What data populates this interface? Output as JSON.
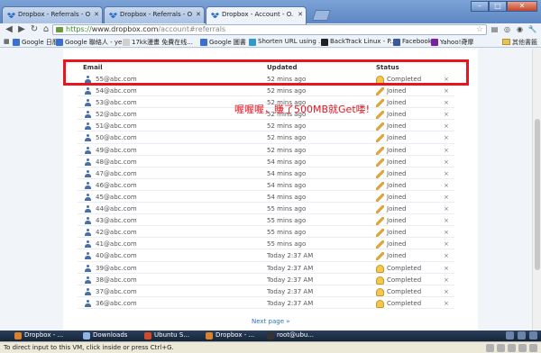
{
  "browser": {
    "tabs": [
      {
        "title": "Dropbox - Referrals - O...",
        "active": false
      },
      {
        "title": "Dropbox - Referrals - O...",
        "active": false
      },
      {
        "title": "Dropbox - Account - O...",
        "active": true
      }
    ],
    "url": {
      "protocol": "https://",
      "domain": "www.dropbox.com",
      "path": "/account#referrals"
    },
    "bookmarks": [
      {
        "label": "Google 日曆",
        "color": "#3b6fd1"
      },
      {
        "label": "Google 聯絡人 - ye...",
        "color": "#3b6fd1"
      },
      {
        "label": "17kk漫畫 免費在线...",
        "color": "#d0d0d0"
      },
      {
        "label": "Google 圖書",
        "color": "#3b6fd1"
      },
      {
        "label": "Shorten URL using ...",
        "color": "#3399cc"
      },
      {
        "label": "BackTrack Linux - P...",
        "color": "#222222"
      },
      {
        "label": "Facebook",
        "color": "#3b5998"
      },
      {
        "label": "Yahoo!奇摩",
        "color": "#7b1fa2"
      }
    ],
    "other_bookmarks": "其他書籤"
  },
  "referrals": {
    "columns": {
      "email": "Email",
      "updated": "Updated",
      "status": "Status"
    },
    "rows": [
      {
        "email": "55@abc.com",
        "updated": "52 mins ago",
        "status": "Completed"
      },
      {
        "email": "54@abc.com",
        "updated": "52 mins ago",
        "status": "Joined"
      },
      {
        "email": "53@abc.com",
        "updated": "52 mins ago",
        "status": "Joined"
      },
      {
        "email": "52@abc.com",
        "updated": "52 mins ago",
        "status": "Joined"
      },
      {
        "email": "51@abc.com",
        "updated": "52 mins ago",
        "status": "Joined"
      },
      {
        "email": "50@abc.com",
        "updated": "52 mins ago",
        "status": "Joined"
      },
      {
        "email": "49@abc.com",
        "updated": "52 mins ago",
        "status": "Joined"
      },
      {
        "email": "48@abc.com",
        "updated": "54 mins ago",
        "status": "Joined"
      },
      {
        "email": "47@abc.com",
        "updated": "54 mins ago",
        "status": "Joined"
      },
      {
        "email": "46@abc.com",
        "updated": "54 mins ago",
        "status": "Joined"
      },
      {
        "email": "45@abc.com",
        "updated": "54 mins ago",
        "status": "Joined"
      },
      {
        "email": "44@abc.com",
        "updated": "55 mins ago",
        "status": "Joined"
      },
      {
        "email": "43@abc.com",
        "updated": "55 mins ago",
        "status": "Joined"
      },
      {
        "email": "42@abc.com",
        "updated": "55 mins ago",
        "status": "Joined"
      },
      {
        "email": "41@abc.com",
        "updated": "55 mins ago",
        "status": "Joined"
      },
      {
        "email": "40@abc.com",
        "updated": "Today 2:37 AM",
        "status": "Joined"
      },
      {
        "email": "39@abc.com",
        "updated": "Today 2:37 AM",
        "status": "Completed"
      },
      {
        "email": "38@abc.com",
        "updated": "Today 2:37 AM",
        "status": "Completed"
      },
      {
        "email": "37@abc.com",
        "updated": "Today 2:37 AM",
        "status": "Completed"
      },
      {
        "email": "36@abc.com",
        "updated": "Today 2:37 AM",
        "status": "Completed"
      }
    ],
    "remove_symbol": "×",
    "next_page": "Next page »"
  },
  "annotation": {
    "text": "喔喔喔，賺了500MB就Get喽!",
    "color": "#e8141e"
  },
  "taskbar": {
    "items": [
      {
        "label": "Dropbox - ...",
        "color": "#d9822b"
      },
      {
        "label": "Downloads",
        "color": "#8fb4e3"
      },
      {
        "label": "Ubuntu S...",
        "color": "#d14b2a"
      },
      {
        "label": "Dropbox - ...",
        "color": "#d9822b"
      },
      {
        "label": "root@ubu...",
        "color": "#333333"
      }
    ]
  },
  "vm_status": "To direct input to this VM, click inside or press Ctrl+G."
}
